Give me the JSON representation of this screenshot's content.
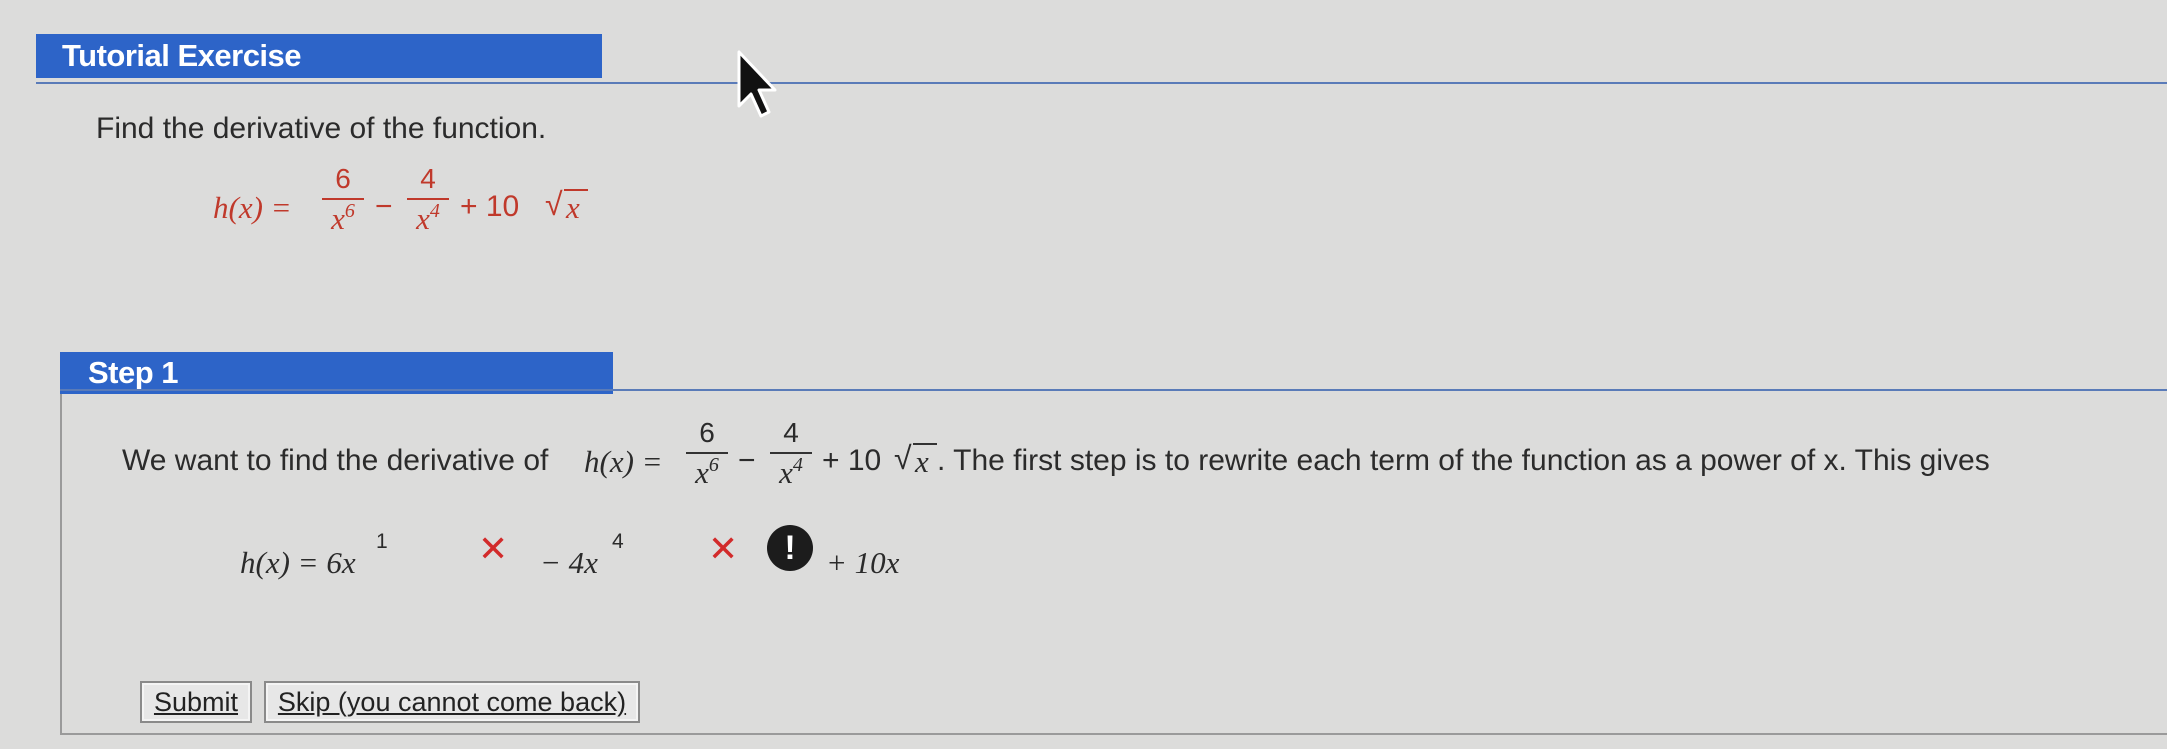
{
  "tutorial": {
    "header": "Tutorial Exercise",
    "prompt": "Find the derivative of the function."
  },
  "function": {
    "lhs": "h(x) =",
    "frac1_num": "6",
    "frac1_den": "x",
    "frac1_exp": "6",
    "minus": "−",
    "frac2_num": "4",
    "frac2_den": "x",
    "frac2_exp": "4",
    "plus_term": "+ 10",
    "sqrt_var": "x"
  },
  "step1": {
    "header": "Step 1",
    "text_before": "We want to find the derivative of",
    "h_eq": "h(x) =",
    "frac1_num": "6",
    "frac1_den": "x",
    "frac1_exp": "6",
    "minus": "−",
    "frac2_num": "4",
    "frac2_den": "x",
    "frac2_exp": "4",
    "plus_term": "+ 10",
    "sqrt_var": "x",
    "text_after": ". The first step is to rewrite each term of the function as a power of x. This gives"
  },
  "answer": {
    "lhs": "h(x) = 6x",
    "exp1_value": "1",
    "term2": "− 4x",
    "exp2_value": "4",
    "term3": "+ 10x",
    "x_mark": "✕",
    "warn_mark": "!"
  },
  "buttons": {
    "submit": "Submit",
    "skip": "Skip (you cannot come back)"
  },
  "icons": [
    "cursor-icon",
    "incorrect-icon",
    "warning-icon",
    "sqrt-icon"
  ]
}
